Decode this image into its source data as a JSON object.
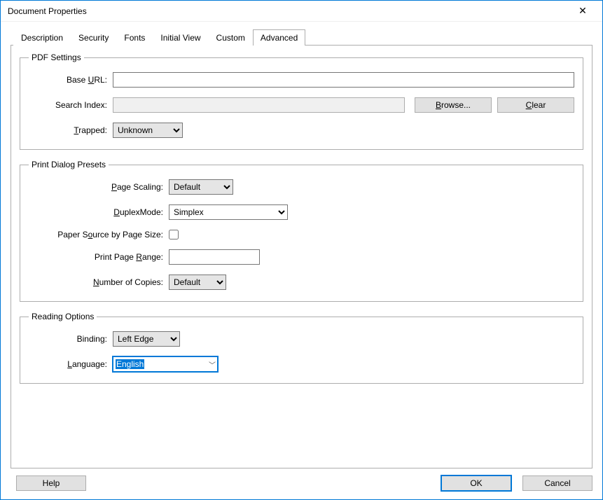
{
  "window": {
    "title": "Document Properties"
  },
  "tabs": {
    "items": [
      {
        "label": "Description"
      },
      {
        "label": "Security"
      },
      {
        "label": "Fonts"
      },
      {
        "label": "Initial View"
      },
      {
        "label": "Custom"
      },
      {
        "label": "Advanced"
      }
    ],
    "active": "Advanced"
  },
  "pdf": {
    "legend": "PDF Settings",
    "baseurl_label_pre": "Base ",
    "baseurl_label_u": "U",
    "baseurl_label_post": "RL:",
    "baseurl_value": "",
    "search_label": "Search Index:",
    "search_value": "",
    "browse_u": "B",
    "browse_rest": "rowse...",
    "clear_u": "C",
    "clear_rest": "lear",
    "trapped_u": "T",
    "trapped_rest": "rapped:",
    "trapped_value": "Unknown"
  },
  "print": {
    "legend": "Print Dialog Presets",
    "pagescaling_u": "P",
    "pagescaling_rest": "age Scaling:",
    "pagescaling_value": "Default",
    "duplex_u": "D",
    "duplex_rest": "uplexMode:",
    "duplex_value": "Simplex",
    "papersrc_pre": "Paper S",
    "papersrc_u": "o",
    "papersrc_post": "urce by Page Size:",
    "papersrc_checked": false,
    "range_pre": "Print Page ",
    "range_u": "R",
    "range_post": "ange:",
    "range_value": "",
    "copies_u": "N",
    "copies_rest": "umber of Copies:",
    "copies_value": "Default"
  },
  "reading": {
    "legend": "Reading Options",
    "binding_pre": "Bindin",
    "binding_u": "g",
    "binding_post": ":",
    "binding_value": "Left Edge",
    "lang_u": "L",
    "lang_rest": "anguage:",
    "lang_value": "English"
  },
  "footer": {
    "help": "Help",
    "ok": "OK",
    "cancel": "Cancel"
  }
}
